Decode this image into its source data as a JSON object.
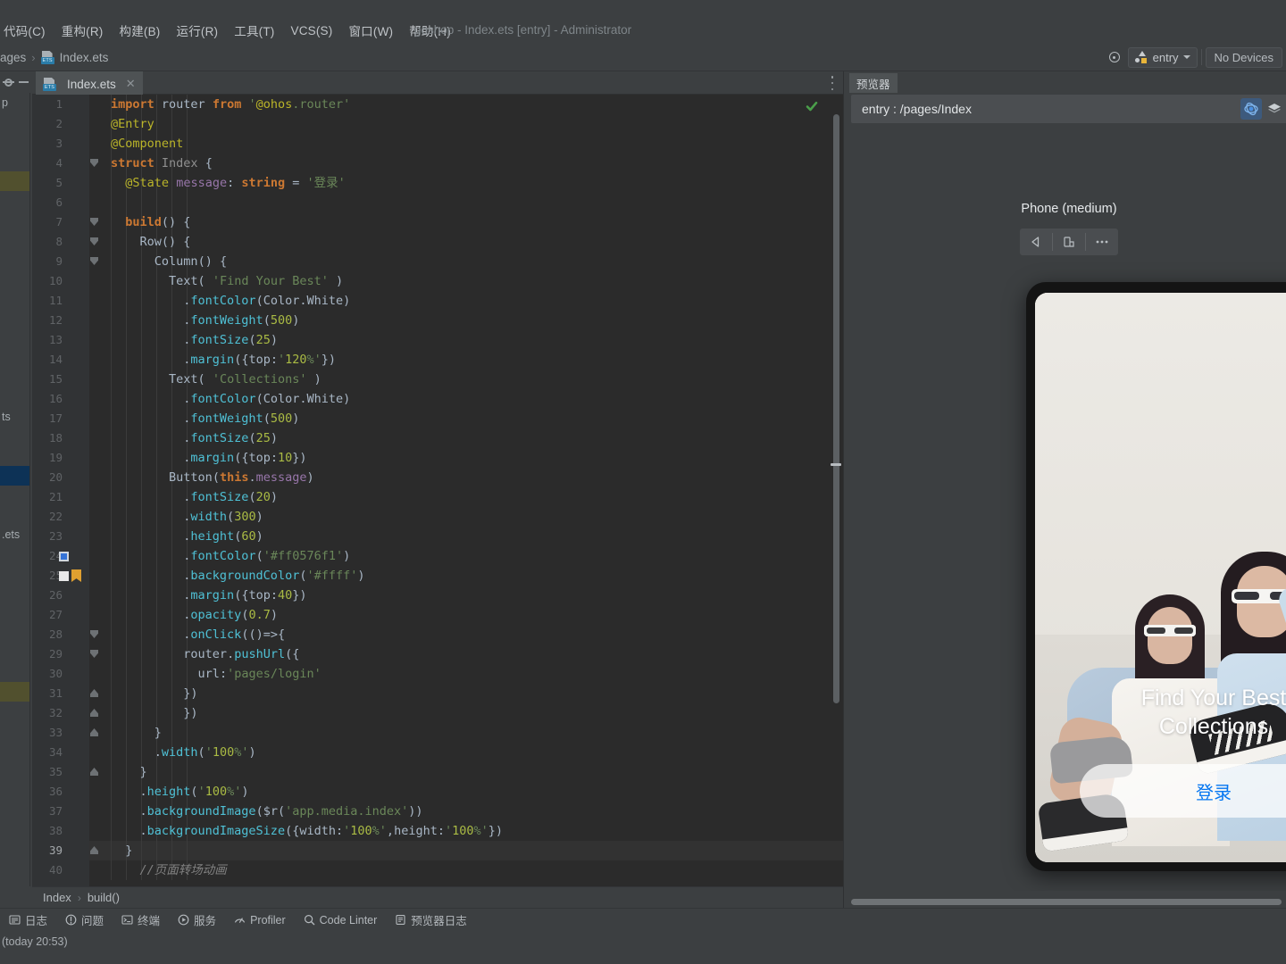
{
  "window": {
    "title": "goshop - Index.ets [entry] - Administrator"
  },
  "menubar": {
    "items": [
      {
        "label": "代码(C)",
        "name": "menu-code"
      },
      {
        "label": "重构(R)",
        "name": "menu-refactor"
      },
      {
        "label": "构建(B)",
        "name": "menu-build"
      },
      {
        "label": "运行(R)",
        "name": "menu-run"
      },
      {
        "label": "工具(T)",
        "name": "menu-tools"
      },
      {
        "label": "VCS(S)",
        "name": "menu-vcs"
      },
      {
        "label": "窗口(W)",
        "name": "menu-window"
      },
      {
        "label": "帮助(H)",
        "name": "menu-help"
      }
    ]
  },
  "breadcrumb": {
    "folder": "ages",
    "separator": "›",
    "file": "Index.ets"
  },
  "toolbar": {
    "target_icon": "target-icon",
    "module": "entry",
    "module_icon": "module-icon",
    "devices": "No Devices"
  },
  "project_tree": {
    "rows": [
      {
        "label": "p",
        "state": "normal"
      },
      {
        "label": "",
        "state": "normal"
      },
      {
        "label": "",
        "state": "normal"
      },
      {
        "label": "",
        "state": "normal"
      },
      {
        "label": "",
        "state": "amber"
      },
      {
        "label": "",
        "state": "normal"
      },
      {
        "label": "",
        "state": "normal"
      },
      {
        "label": "",
        "state": "normal"
      },
      {
        "label": "",
        "state": "normal"
      },
      {
        "label": "",
        "state": "normal"
      },
      {
        "label": "",
        "state": "normal"
      },
      {
        "label": "",
        "state": "normal"
      },
      {
        "label": "",
        "state": "normal"
      },
      {
        "label": "",
        "state": "normal"
      },
      {
        "label": "",
        "state": "normal"
      },
      {
        "label": "",
        "state": "normal"
      },
      {
        "label": "ts",
        "state": "normal"
      },
      {
        "label": "",
        "state": "normal"
      },
      {
        "label": "",
        "state": "normal"
      },
      {
        "label": "",
        "state": "blue"
      },
      {
        "label": "",
        "state": "normal"
      },
      {
        "label": "",
        "state": "normal"
      },
      {
        "label": ".ets",
        "state": "normal"
      },
      {
        "label": "",
        "state": "normal"
      },
      {
        "label": "",
        "state": "normal"
      },
      {
        "label": "",
        "state": "normal"
      },
      {
        "label": "",
        "state": "normal"
      },
      {
        "label": "",
        "state": "normal"
      },
      {
        "label": "",
        "state": "normal"
      },
      {
        "label": "",
        "state": "normal"
      },
      {
        "label": "",
        "state": "amber"
      }
    ]
  },
  "editor": {
    "tab": {
      "label": "Index.ets",
      "close": "✕"
    },
    "current_line": 39,
    "total_visible_lines": 40,
    "inspection_status": "ok",
    "breadcrumb": {
      "scope": "Index",
      "member": "build()",
      "sep": "›"
    },
    "lines": [
      {
        "n": 1,
        "text": "import router from '@ohos.router'"
      },
      {
        "n": 2,
        "text": "@Entry"
      },
      {
        "n": 3,
        "text": "@Component"
      },
      {
        "n": 4,
        "text": "struct Index {"
      },
      {
        "n": 5,
        "text": "  @State message: string = '登录'"
      },
      {
        "n": 6,
        "text": ""
      },
      {
        "n": 7,
        "text": "  build() {"
      },
      {
        "n": 8,
        "text": "    Row() {"
      },
      {
        "n": 9,
        "text": "      Column() {"
      },
      {
        "n": 10,
        "text": "        Text( 'Find Your Best' )"
      },
      {
        "n": 11,
        "text": "          .fontColor(Color.White)"
      },
      {
        "n": 12,
        "text": "          .fontWeight(500)"
      },
      {
        "n": 13,
        "text": "          .fontSize(25)"
      },
      {
        "n": 14,
        "text": "          .margin({top:'120%'})"
      },
      {
        "n": 15,
        "text": "        Text( 'Collections' )"
      },
      {
        "n": 16,
        "text": "          .fontColor(Color.White)"
      },
      {
        "n": 17,
        "text": "          .fontWeight(500)"
      },
      {
        "n": 18,
        "text": "          .fontSize(25)"
      },
      {
        "n": 19,
        "text": "          .margin({top:10})"
      },
      {
        "n": 20,
        "text": "        Button(this.message)"
      },
      {
        "n": 21,
        "text": "          .fontSize(20)"
      },
      {
        "n": 22,
        "text": "          .width(300)"
      },
      {
        "n": 23,
        "text": "          .height(60)"
      },
      {
        "n": 24,
        "text": "          .fontColor('#ff0576f1')"
      },
      {
        "n": 25,
        "text": "          .backgroundColor('#ffff')"
      },
      {
        "n": 26,
        "text": "          .margin({top:40})"
      },
      {
        "n": 27,
        "text": "          .opacity(0.7)"
      },
      {
        "n": 28,
        "text": "          .onClick(()=>{"
      },
      {
        "n": 29,
        "text": "          router.pushUrl({"
      },
      {
        "n": 30,
        "text": "            url:'pages/login'"
      },
      {
        "n": 31,
        "text": "          })"
      },
      {
        "n": 32,
        "text": "          })"
      },
      {
        "n": 33,
        "text": "      }"
      },
      {
        "n": 34,
        "text": "      .width('100%')"
      },
      {
        "n": 35,
        "text": "    }"
      },
      {
        "n": 36,
        "text": "    .height('100%')"
      },
      {
        "n": 37,
        "text": "    .backgroundImage($r('app.media.index'))"
      },
      {
        "n": 38,
        "text": "    .backgroundImageSize({width:'100%',height:'100%'})"
      },
      {
        "n": 39,
        "text": "  }"
      },
      {
        "n": 40,
        "text": "    //页面转场动画"
      }
    ],
    "gutter_marks": [
      {
        "line": 24,
        "icon": "blue-square-icon",
        "color": "#3573d6"
      },
      {
        "line": 25,
        "icon": "white-square-icon",
        "color": "#e8e8e8"
      },
      {
        "line": 25,
        "icon": "bookmark-icon",
        "color": "#e0a030"
      }
    ]
  },
  "statusbar": {
    "items": [
      {
        "label": "日志",
        "icon": "log-icon"
      },
      {
        "label": "问题",
        "icon": "problems-icon"
      },
      {
        "label": "终端",
        "icon": "terminal-icon"
      },
      {
        "label": "服务",
        "icon": "services-icon"
      },
      {
        "label": "Profiler",
        "icon": "profiler-icon"
      },
      {
        "label": "Code Linter",
        "icon": "linter-icon"
      },
      {
        "label": "预览器日志",
        "icon": "previewer-log-icon"
      }
    ],
    "message": "(today 20:53)"
  },
  "preview": {
    "tab_label": "预览器",
    "path": "entry : /pages/Index",
    "tools": [
      {
        "name": "inspector-icon",
        "active": true
      },
      {
        "name": "layers-icon",
        "active": false
      }
    ],
    "device_label": "Phone (medium)",
    "device_controls": [
      {
        "name": "rotate-left-icon",
        "glyph": "◁"
      },
      {
        "name": "orientation-icon",
        "glyph": "▯"
      },
      {
        "name": "more-options-icon",
        "glyph": "•••"
      }
    ],
    "app": {
      "title_line1": "Find Your Best",
      "title_line2": "Collections",
      "button_label": "登录",
      "button_text_color": "#0576f1",
      "title_color": "#ffffff"
    }
  }
}
